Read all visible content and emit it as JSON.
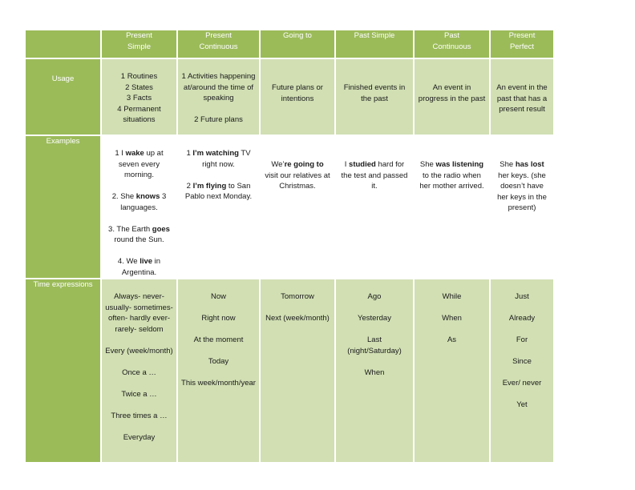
{
  "table": {
    "columns": [
      "Present Simple",
      "Present Continuous",
      "Going to",
      "Past Simple",
      "Past Continuous",
      "Present Perfect"
    ],
    "column_lines": [
      [
        "Present",
        "Simple"
      ],
      [
        "Present",
        "Continuous"
      ],
      [
        "Going to"
      ],
      [
        "Past Simple"
      ],
      [
        "Past",
        "Continuous"
      ],
      [
        "Present",
        "Perfect"
      ]
    ],
    "rows": {
      "usage": {
        "label": "Usage",
        "cells": [
          [
            "1 Routines",
            "2 States",
            "3 Facts",
            "4 Permanent situations"
          ],
          [
            "1 Activities happening at/around the time of speaking",
            "",
            "2 Future plans"
          ],
          [
            "Future plans or intentions"
          ],
          [
            "Finished events in the past"
          ],
          [
            "An event in progress in the past"
          ],
          [
            "An event in the past that has a present result"
          ]
        ]
      },
      "examples": {
        "label": "Examples",
        "cells": [
          [
            {
              "pre": " 1 I ",
              "bold": "wake",
              "post": " up at seven every morning."
            },
            {
              "pre": "2. She ",
              "bold": "knows",
              "post": " 3 languages."
            },
            {
              "pre": "3. The Earth ",
              "bold": "goes",
              "post": " round the Sun."
            },
            {
              "pre": "4. We ",
              "bold": "live",
              "post": " in Argentina."
            }
          ],
          [
            {
              "pre": "1 ",
              "bold": "I’m watching",
              "post": " TV right now."
            },
            {
              "pre": "2 ",
              "bold": "I’m flying",
              "post": " to San Pablo next Monday."
            }
          ],
          [
            {
              "pre": "We’",
              "bold": "re going to",
              "post": " visit our relatives at Christmas."
            }
          ],
          [
            {
              "pre": "I ",
              "bold": "studied",
              "post": " hard for the test and passed it."
            }
          ],
          [
            {
              "pre": "She ",
              "bold": "was listening",
              "post": " to the radio when her mother arrived."
            }
          ],
          [
            {
              "pre": "She ",
              "bold": "has lost",
              "post": " her keys. (she doesn’t have her keys in the present)"
            }
          ]
        ]
      },
      "time": {
        "label": "Time expressions",
        "cells": [
          [
            "Always- never- usually- sometimes- often- hardly ever- rarely- seldom",
            "Every (week/month)",
            "Once a …",
            "Twice a …",
            "Three times a …",
            "Everyday"
          ],
          [
            "Now",
            "Right now",
            "At the moment",
            "Today",
            "This week/month/year"
          ],
          [
            "Tomorrow",
            "Next (week/month)"
          ],
          [
            "Ago",
            "Yesterday",
            "Last (night/Saturday)",
            "When"
          ],
          [
            "While",
            "When",
            "As"
          ],
          [
            "Just",
            "Already",
            "For",
            "Since",
            "Ever/ never",
            "Yet"
          ]
        ]
      }
    },
    "colors": {
      "header_green": "#9bbb59",
      "light_green": "#d1dfb3",
      "header_text": "#ffffff"
    }
  }
}
